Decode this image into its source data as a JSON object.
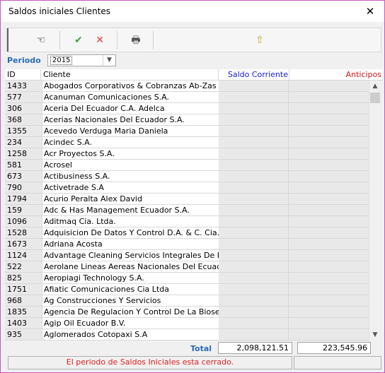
{
  "window": {
    "title": "Saldos iniciales Clientes",
    "close_glyph": "✕"
  },
  "toolbar": {
    "buttons": [
      {
        "name": "edit-hand-icon",
        "glyph": "☜"
      },
      {
        "name": "accept-check-icon",
        "glyph": "✔",
        "color": "#3aa43a"
      },
      {
        "name": "cancel-x-icon",
        "glyph": "✕",
        "color": "#e04040"
      },
      {
        "name": "printer-icon",
        "glyph": "🖶"
      },
      {
        "name": "export-folder-icon",
        "glyph": "⇧"
      }
    ]
  },
  "period": {
    "label": "Periodo",
    "value": "2015"
  },
  "grid": {
    "headers": {
      "id": "ID",
      "cliente": "Cliente",
      "saldo": "Saldo Corriente",
      "anticipos": "Anticipos"
    },
    "header_colors": {
      "saldo": "#1a1ad0",
      "anticipos": "#d01818"
    },
    "rows": [
      {
        "id": "1433",
        "name": "Abogados Corporativos & Cobranzas Ab-Zas Sa"
      },
      {
        "id": "577",
        "name": "Acanuman Comunicaciones S.A."
      },
      {
        "id": "306",
        "name": "Aceria Del Ecuador C.A. Adelca"
      },
      {
        "id": "368",
        "name": "Acerias Nacionales Del Ecuador S.A."
      },
      {
        "id": "1355",
        "name": "Acevedo Verduga Maria Daniela"
      },
      {
        "id": "234",
        "name": "Acindec S.A."
      },
      {
        "id": "1258",
        "name": "Acr Proyectos S.A."
      },
      {
        "id": "581",
        "name": "Acrosel"
      },
      {
        "id": "673",
        "name": "Actibusiness S.A."
      },
      {
        "id": "790",
        "name": "Activetrade S.A"
      },
      {
        "id": "1794",
        "name": "Acurio Peralta Alex David"
      },
      {
        "id": "159",
        "name": "Adc &  Has Management Ecuador S.A."
      },
      {
        "id": "1096",
        "name": "Aditmaq Cia. Ltda."
      },
      {
        "id": "1528",
        "name": "Adquisicion De Datos Y Control D.A. & C. Cia. Ltda"
      },
      {
        "id": "1673",
        "name": "Adriana Acosta"
      },
      {
        "id": "1124",
        "name": "Advantage Cleaning Servicios Integrales De Limpieza"
      },
      {
        "id": "522",
        "name": "Aerolane Lineas Aereas Nacionales Del Ecuador S.A."
      },
      {
        "id": "825",
        "name": "Aeropiagi  Technology  S.A."
      },
      {
        "id": "1751",
        "name": "Afiatic Comunicaciones Cia Ltda"
      },
      {
        "id": "968",
        "name": "Ag Construcciones Y Servicios"
      },
      {
        "id": "1835",
        "name": "Agencia De Regulacion Y Control De La Bioseguridad"
      },
      {
        "id": "1403",
        "name": "Agip Oil Ecuador B.V."
      },
      {
        "id": "935",
        "name": "Aglomerados Cotopaxi S.A"
      }
    ]
  },
  "totals": {
    "label": "Total",
    "saldo": "2,098,121.51",
    "anticipos": "223,545.96"
  },
  "status": {
    "message": "El periodo de Saldos Iniciales esta cerrado.",
    "color": "#e02020"
  }
}
